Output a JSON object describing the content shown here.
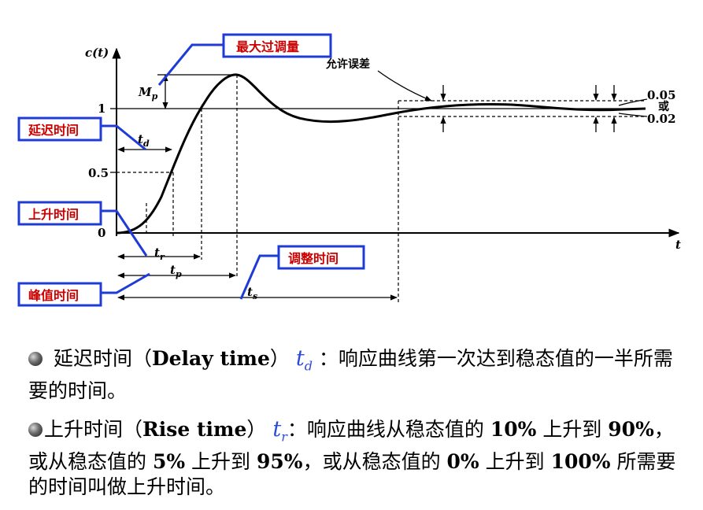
{
  "figure": {
    "y_axis_label": "c(t)",
    "x_axis_label": "t",
    "tick_1": "1",
    "tick_05": "0.5",
    "tick_0": "0",
    "mp_label": "M",
    "mp_sub": "p",
    "td_label": "t",
    "td_sub": "d",
    "tr_label": "t",
    "tr_sub": "r",
    "tp_label": "t",
    "tp_sub": "p",
    "ts_label": "t",
    "ts_sub": "s",
    "tolerance_label": "允许误差",
    "tol_value_1": "0.05",
    "tol_or": "或",
    "tol_value_2": "0.02",
    "box_max_overshoot": "最大过调量",
    "box_delay_time": "延迟时间",
    "box_rise_time": "上升时间",
    "box_peak_time": "峰值时间",
    "box_settling_time": "调整时间"
  },
  "paragraph1": {
    "text_a": "延迟时间（",
    "text_en": "Delay time",
    "text_b": "）",
    "sym": "t",
    "sym_sub": "d",
    "text_c": "：响应曲线第一次达到稳态值的一半所需要的时间。"
  },
  "paragraph2": {
    "text_a": "上升时间（",
    "text_en": "Rise time",
    "text_b": "）",
    "sym": "t",
    "sym_sub": "r",
    "text_c": "：响应曲线从稳态值的 ",
    "p10": "10%",
    "text_d": " 上升到 ",
    "p90": "90%",
    "text_e": "，或从稳态值的 ",
    "p5": "5%",
    "text_f": " 上升到 ",
    "p95": "95%",
    "text_g": "，或从稳态值的 ",
    "p0": "0%",
    "text_h": " 上升到 ",
    "p100": "100%",
    "text_i": " 所需要的时间叫做上升时间。"
  }
}
